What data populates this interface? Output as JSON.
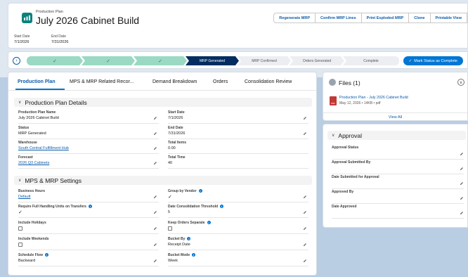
{
  "header": {
    "record_type": "Production Plan",
    "title": "July 2026 Cabinet Build",
    "buttons": [
      "Regenerate MRP",
      "Confirm MRP Lines",
      "Print Exploded MRP",
      "Clone",
      "Printable View"
    ],
    "highlights": [
      {
        "label": "Start Date",
        "value": "7/1/2026"
      },
      {
        "label": "End Date",
        "value": "7/31/2026"
      }
    ]
  },
  "path": {
    "stages": [
      "✓",
      "✓",
      "✓",
      "MRP Generated",
      "MRP Confirmed",
      "Orders Generated",
      "Complete"
    ],
    "mark_button": "Mark Status as Complete"
  },
  "tabs": [
    "Production Plan",
    "MPS & MRP Related Recor...",
    "Demand Breakdown",
    "Orders",
    "Consolidation Review"
  ],
  "details": {
    "section_title": "Production Plan Details",
    "left": [
      {
        "label": "Production Plan Name",
        "value": "July 2026 Cabinet Build"
      },
      {
        "label": "Status",
        "value": "MRP Generated"
      },
      {
        "label": "Warehouse",
        "value": "South Central Fulfillment Hub"
      },
      {
        "label": "Forecast",
        "value": "2026 Q3 Cabinets"
      }
    ],
    "right": [
      {
        "label": "Start Date",
        "value": "7/1/2026"
      },
      {
        "label": "End Date",
        "value": "7/31/2026"
      },
      {
        "label": "Total Items",
        "value": "0.00"
      },
      {
        "label": "Total Time",
        "value": "40"
      }
    ]
  },
  "settings": {
    "section_title": "MPS & MRP Settings",
    "left": [
      {
        "label": "Business Hours",
        "value": "Default"
      },
      {
        "label": "Require Full Handling Units on Transfers",
        "value": "✓"
      },
      {
        "label": "Include Holidays",
        "value": ""
      },
      {
        "label": "Include Weekends",
        "value": ""
      },
      {
        "label": "Schedule Flow",
        "value": "Backward"
      }
    ],
    "right": [
      {
        "label": "Group by Vendor",
        "value": "✓"
      },
      {
        "label": "Date Consolidation Threshold",
        "value": "5"
      },
      {
        "label": "Keep Orders Separate",
        "value": ""
      },
      {
        "label": "Bucket By",
        "value": "Receipt Date"
      },
      {
        "label": "Bucket Mode",
        "value": "Week"
      }
    ]
  },
  "files": {
    "title": "Files (1)",
    "file_name": "Production Plan - July 2026 Cabinet Build",
    "file_meta": "May 12, 2026 • 14KB • pdf",
    "file_type": "PDF",
    "view_all": "View All"
  },
  "approval": {
    "title": "Approval",
    "fields": [
      "Approval Status",
      "Approval Submitted By",
      "Date Submitted for Approval",
      "Approved By",
      "Date Approved"
    ]
  },
  "colors": {
    "brand": "#0176d3",
    "path_done": "#9ad9c4",
    "path_current": "#032d60",
    "app_icon": "#0b827c"
  }
}
